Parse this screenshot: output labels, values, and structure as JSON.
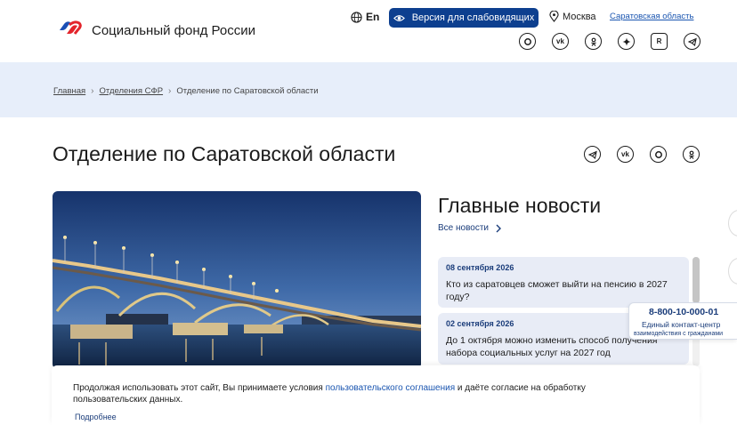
{
  "header": {
    "brand": "Социальный фонд России",
    "lang": "En",
    "vision_button": "Версия для слабовидящих",
    "city": "Москва",
    "region_link": "Саратовская область",
    "social_icons": [
      "max-icon",
      "vk-icon",
      "ok-icon",
      "dzen-icon",
      "rutube-icon",
      "telegram-icon"
    ]
  },
  "breadcrumb": {
    "home": "Главная",
    "sep": "›",
    "branches": "Отделения СФР",
    "current": "Отделение по Саратовской области"
  },
  "page": {
    "title": "Отделение по Саратовской области"
  },
  "news": {
    "title": "Главные новости",
    "all_link": "Все новости",
    "items": [
      {
        "date": "08 сентября 2026",
        "text": "Кто из саратовцев сможет выйти на пенсию в 2027 году?"
      },
      {
        "date": "02 сентября 2026",
        "text": "До 1 октября можно изменить способ получения набора социальных услуг на 2027 год"
      }
    ]
  },
  "contact": {
    "phone": "8-800-10-000-01",
    "label": "Единый контакт-центр",
    "sublabel": "взаимодействия с гражданами"
  },
  "cookie": {
    "text_before": "Продолжая использовать этот сайт, Вы принимаете условия ",
    "link": "пользовательского соглашения",
    "text_after": " и даёте согласие на обработку пользовательских данных.",
    "more": "Подробнее"
  },
  "colors": {
    "primary": "#0d3f8f",
    "link": "#1a55b0",
    "band": "#e7eefa",
    "card": "#e8ecf6"
  }
}
